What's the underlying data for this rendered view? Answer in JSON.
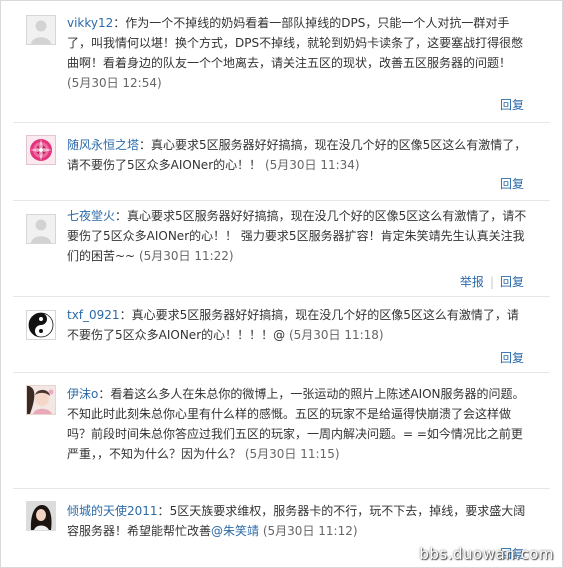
{
  "comments": [
    {
      "user": "vikky12",
      "body": "作为一个不掉线的奶妈看着一部队掉线的DPS，只能一个人对抗一群对手了，叫我情何以堪！换个方式，DPS不掉线，就轮到奶妈卡读条了，这要塞战打得很憋曲啊！看着身边的队友一个个地离去，请关注五区的现状，改善五区服务器的问题！",
      "time": "(5月30日 12:54)",
      "actions": [
        "回复"
      ]
    },
    {
      "user": "随风永恒之塔",
      "body": "真心要求5区服务器好好搞搞，现在没几个好的区像5区这么有激情了，请不要伤了5区众多AIONer的心！！",
      "time": "(5月30日 11:34)",
      "actions": [
        "回复"
      ]
    },
    {
      "user": "七夜堂火",
      "body": "真心要求5区服务器好好搞搞，现在没几个好的区像5区这么有激情了，请不要伤了5区众多AIONer的心！！ 强力要求5区服务器扩容！肯定朱笑靖先生认真关注我们的困苦~~",
      "time": "(5月30日 11:22)",
      "actions": [
        "举报",
        "回复"
      ]
    },
    {
      "user": "txf_0921",
      "body": "真心要求5区服务器好好搞搞，现在没几个好的区像5区这么有激情了，请不要伤了5区众多AIONer的心！！！！@",
      "time": "(5月30日 11:18)",
      "actions": [
        "回复"
      ]
    },
    {
      "user": "伊沫o",
      "body": "看着这么多人在朱总你的微博上，一张运动的照片上陈述AION服务器的问题。不知此时此刻朱总你心里有什么样的感慨。五区的玩家不是给逼得快崩溃了会这样做吗？前段时间朱总你答应过我们五区的玩家，一周内解决问题。= =如今情况比之前更严重，，不知为什么？因为什么？",
      "time": "(5月30日 11:15)",
      "actions": []
    },
    {
      "user": "倾城的天使2011",
      "body": "5区天族要求维权，服务器卡的不行，玩不下去，掉线，要求盛大阔容服务器！希望能帮忙改善",
      "mention": "@朱笑靖",
      "time": "(5月30日 11:12)",
      "actions": [
        "回复"
      ]
    }
  ],
  "watermark": "bbs.duowan.com",
  "colors": {
    "link": "#2b6aa8",
    "text": "#333333",
    "separator": "#e6e6e6"
  }
}
